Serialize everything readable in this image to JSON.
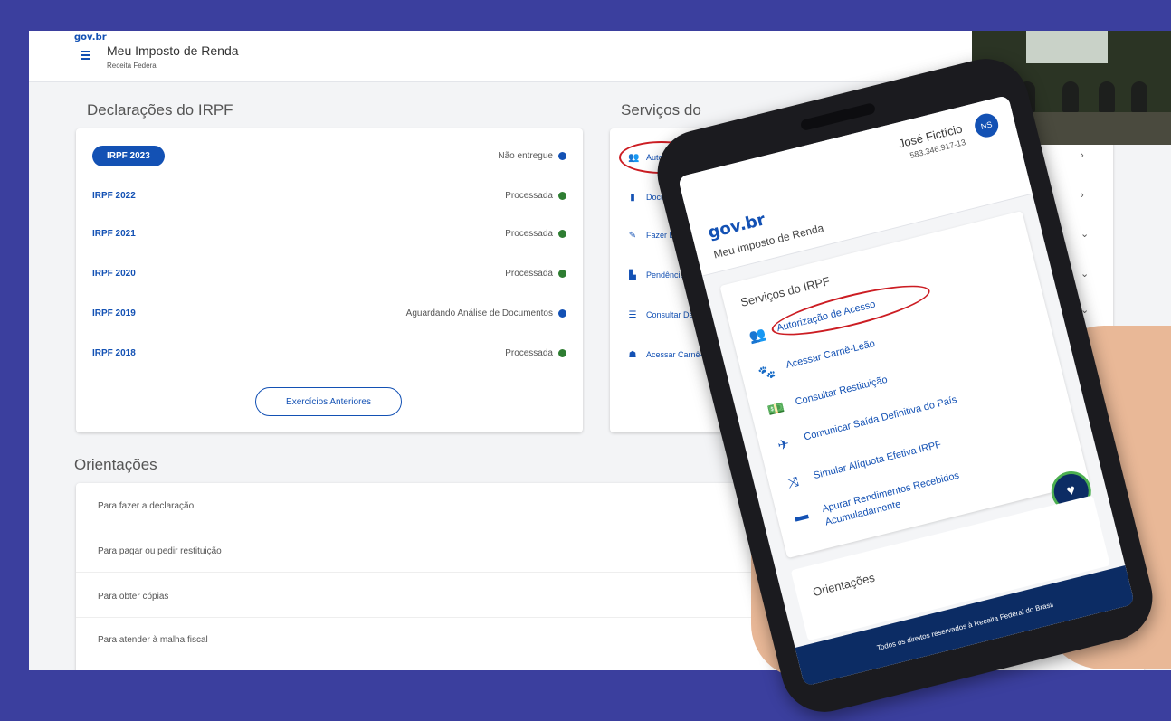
{
  "app": {
    "brand": "gov.br",
    "title": "Meu Imposto de Renda",
    "subtitle": "Receita Federal"
  },
  "declaracoes": {
    "title": "Declarações do IRPF",
    "rows": [
      {
        "year": "IRPF 2023",
        "status": "Não entregue",
        "dot": "#1351b4"
      },
      {
        "year": "IRPF 2022",
        "status": "Processada",
        "dot": "#2e7d32"
      },
      {
        "year": "IRPF 2021",
        "status": "Processada",
        "dot": "#2e7d32"
      },
      {
        "year": "IRPF 2020",
        "status": "Processada",
        "dot": "#2e7d32"
      },
      {
        "year": "IRPF 2019",
        "status": "Aguardando Análise de Documentos",
        "dot": "#1351b4"
      },
      {
        "year": "IRPF 2018",
        "status": "Processada",
        "dot": "#2e7d32"
      }
    ],
    "button": "Exercícios Anteriores"
  },
  "servicos": {
    "title": "Serviços do",
    "items": [
      {
        "icon": "user-plus-icon",
        "glyph": "👥",
        "label": "Autoriza"
      },
      {
        "icon": "document-icon",
        "glyph": "▮",
        "label": "Document"
      },
      {
        "icon": "edit-icon",
        "glyph": "✎",
        "label": "Fazer Declara"
      },
      {
        "icon": "pending-icon",
        "glyph": "▙",
        "label": "Pendências de M"
      },
      {
        "icon": "list-icon",
        "glyph": "☰",
        "label": "Consultar Detalhes E"
      },
      {
        "icon": "lion-icon",
        "glyph": "☗",
        "label": "Acessar Carnê-Leão"
      }
    ],
    "chevrons": [
      "›",
      "›",
      "⌄",
      "⌄",
      "⌄"
    ]
  },
  "orientacoes": {
    "title": "Orientações",
    "items": [
      "Para fazer a declaração",
      "Para pagar ou pedir restituição",
      "Para obter cópias",
      "Para atender à malha fiscal"
    ]
  },
  "phone": {
    "user_name": "José Fictício",
    "cpf": "583.346.917-13",
    "avatar": "NS",
    "brand": "gov.br",
    "title": "Meu Imposto de Renda",
    "services_title": "Serviços do IRPF",
    "items": [
      {
        "icon": "user-plus-icon",
        "glyph": "👥",
        "label": "Autorização de Acesso"
      },
      {
        "icon": "paw-icon",
        "glyph": "🐾",
        "label": "Acessar Carnê-Leão"
      },
      {
        "icon": "money-icon",
        "glyph": "💵",
        "label": "Consultar Restituição"
      },
      {
        "icon": "plane-icon",
        "glyph": "✈",
        "label": "Comunicar Saída Definitiva do País"
      },
      {
        "icon": "shuffle-icon",
        "glyph": "⤨",
        "label": "Simular Alíquota Efetiva IRPF"
      },
      {
        "icon": "briefcase-icon",
        "glyph": "▬",
        "label": "Apurar Rendimentos Recebidos Acumuladamente"
      }
    ],
    "orient_title": "Orientações",
    "footer": "Todos os direitos reservados à Receita Federal do Brasil",
    "colors": {
      "primary": "#1351b4",
      "footer": "#0c2c64",
      "highlight": "#cc1d23"
    }
  }
}
